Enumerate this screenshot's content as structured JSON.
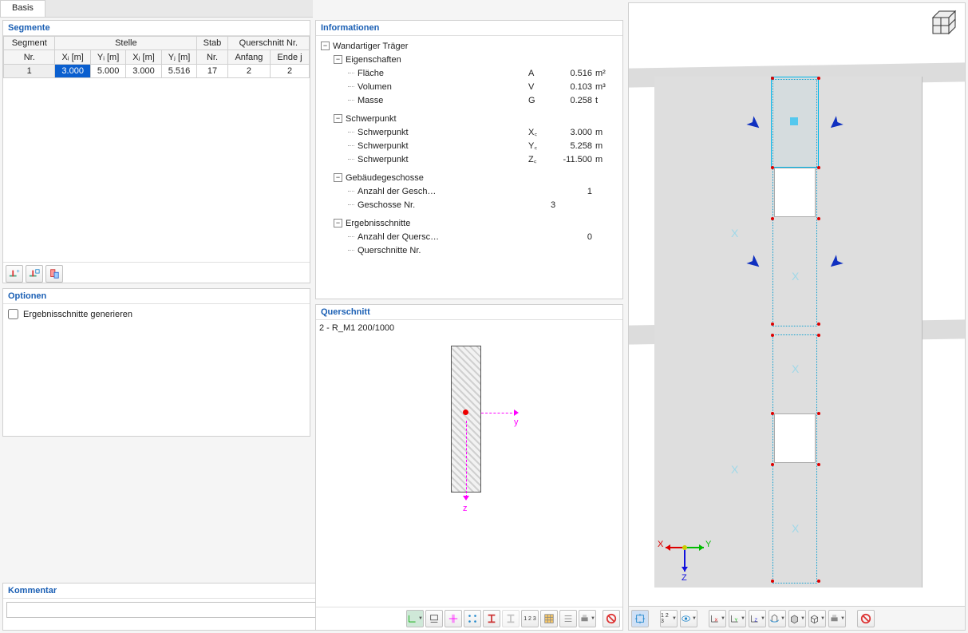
{
  "tabs": {
    "basis": "Basis"
  },
  "segmente": {
    "title": "Segmente",
    "headers": {
      "segment": "Segment",
      "nr": "Nr.",
      "stelle": "Stelle",
      "xi": "Xᵢ [m]",
      "yi": "Yᵢ [m]",
      "xj": "Xⱼ [m]",
      "yj": "Yⱼ [m]",
      "stab": "Stab",
      "stabnr": "Nr.",
      "qsnr": "Querschnitt Nr.",
      "anfang": "Anfang",
      "ende": "Ende j"
    },
    "rows": [
      {
        "nr": "1",
        "xi": "3.000",
        "yi": "5.000",
        "xj": "3.000",
        "yj": "5.516",
        "stab": "17",
        "anfang": "2",
        "ende": "2"
      }
    ]
  },
  "optionen": {
    "title": "Optionen",
    "ergschn": "Ergebnisschnitte generieren"
  },
  "info": {
    "title": "Informationen",
    "root": "Wandartiger Träger",
    "eigenschaften": "Eigenschaften",
    "flaeche": {
      "label": "Fläche",
      "sym": "A",
      "val": "0.516",
      "unit": "m²"
    },
    "volumen": {
      "label": "Volumen",
      "sym": "V",
      "val": "0.103",
      "unit": "m³"
    },
    "masse": {
      "label": "Masse",
      "sym": "G",
      "val": "0.258",
      "unit": "t"
    },
    "schwerpunkt": "Schwerpunkt",
    "xc": {
      "label": "Schwerpunkt",
      "sym": "X꜀",
      "val": "3.000",
      "unit": "m"
    },
    "yc": {
      "label": "Schwerpunkt",
      "sym": "Y꜀",
      "val": "5.258",
      "unit": "m"
    },
    "zc": {
      "label": "Schwerpunkt",
      "sym": "Z꜀",
      "val": "-11.500",
      "unit": "m"
    },
    "geschosse": "Gebäudegeschosse",
    "anz_gesch": {
      "label": "Anzahl der Gesch…",
      "val": "1"
    },
    "gesch_nr": {
      "label": "Geschosse Nr.",
      "val": "3"
    },
    "ergschn": "Ergebnisschnitte",
    "anz_qs": {
      "label": "Anzahl der Quersc…",
      "val": "0"
    },
    "qs_nr": {
      "label": "Querschnitte Nr."
    }
  },
  "querschnitt": {
    "title": "Querschnitt",
    "desc": "2 - R_M1 200/1000",
    "y": "y",
    "z": "z"
  },
  "kommentar": {
    "title": "Kommentar"
  },
  "viewport": {
    "axisX": "X",
    "axisY": "Y",
    "axisZ": "Z"
  }
}
